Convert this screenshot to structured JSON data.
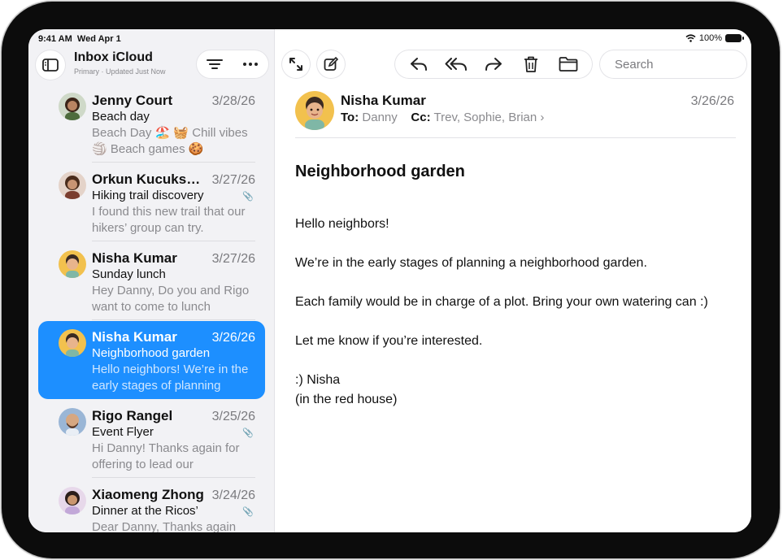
{
  "status": {
    "time": "9:41 AM",
    "date": "Wed Apr 1",
    "battery": "100%"
  },
  "sidebar": {
    "title": "Inbox iCloud",
    "subtitle": "Primary · Updated Just Now",
    "items": [
      {
        "sender": "Jenny Court",
        "date": "3/28/26",
        "subject": "Beach day",
        "preview": "Beach Day 🏖️ 🧺 Chill vibes 🏐 Beach games 🍪",
        "attachment": false
      },
      {
        "sender": "Orkun Kucuksevim",
        "date": "3/27/26",
        "subject": "Hiking trail discovery",
        "preview": "I found this new trail that our hikers’ group can try.",
        "attachment": true
      },
      {
        "sender": "Nisha Kumar",
        "date": "3/27/26",
        "subject": "Sunday lunch",
        "preview": "Hey Danny, Do you and Rigo want to come to lunch",
        "attachment": false
      },
      {
        "sender": "Nisha Kumar",
        "date": "3/26/26",
        "subject": "Neighborhood garden",
        "preview": "Hello neighbors! We’re in the early stages of planning",
        "attachment": false,
        "selected": true
      },
      {
        "sender": "Rigo Rangel",
        "date": "3/25/26",
        "subject": "Event Flyer",
        "preview": "Hi Danny! Thanks again for offering to lead our",
        "attachment": true
      },
      {
        "sender": "Xiaomeng Zhong",
        "date": "3/24/26",
        "subject": "Dinner at the Ricos’",
        "preview": "Dear Danny, Thanks again",
        "attachment": true
      }
    ]
  },
  "search": {
    "placeholder": "Search"
  },
  "message": {
    "sender": "Nisha Kumar",
    "date": "3/26/26",
    "to_label": "To:",
    "to": "Danny",
    "cc_label": "Cc:",
    "cc": "Trev, Sophie, Brian",
    "subject": "Neighborhood garden",
    "body": [
      "Hello neighbors!",
      "We’re in the early stages of planning a neighborhood garden.",
      "Each family would be in charge of a plot. Bring your own watering can :)",
      "Let me know if you’re interested.",
      ":) Nisha",
      "(in the red house)"
    ]
  },
  "colors": {
    "accent": "#1d8fff",
    "sidebar_bg": "#f2f2f5"
  }
}
